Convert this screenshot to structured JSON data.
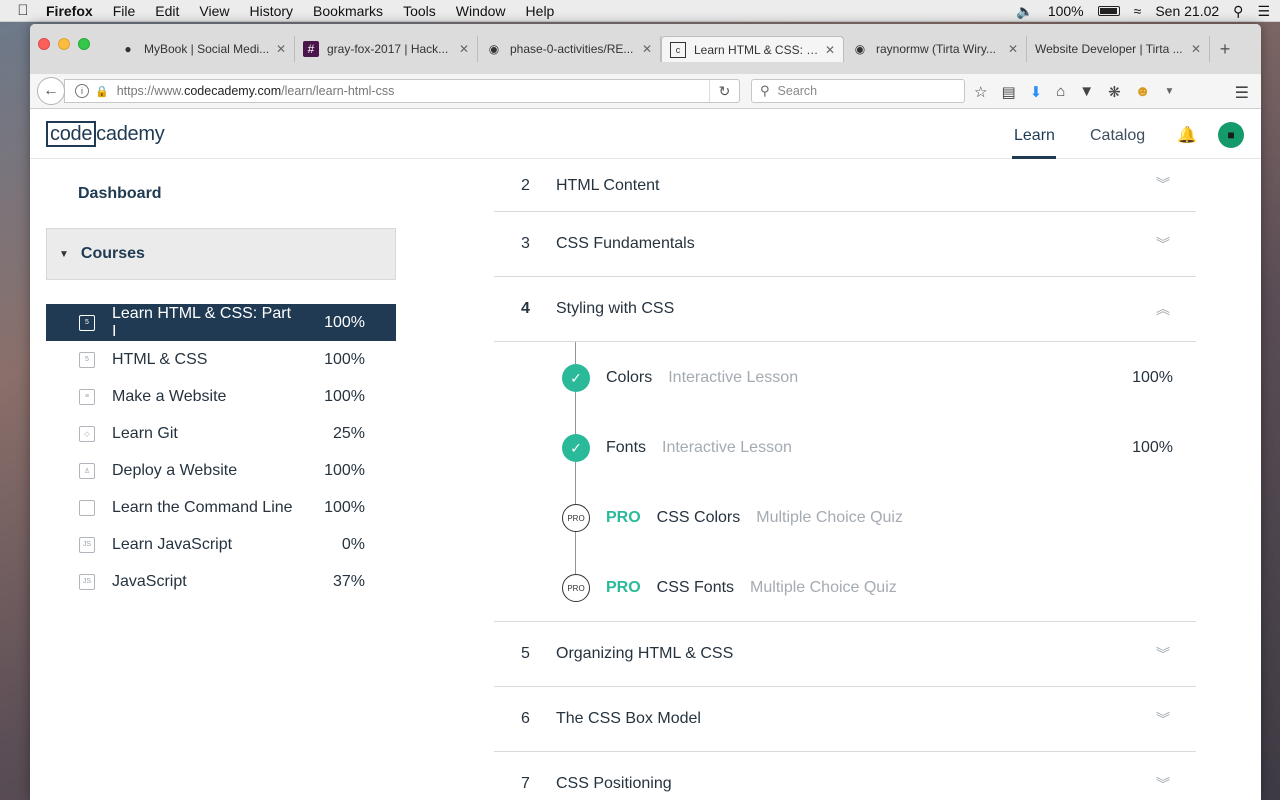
{
  "menubar": {
    "apple": "",
    "items": [
      "Firefox",
      "File",
      "Edit",
      "View",
      "History",
      "Bookmarks",
      "Tools",
      "Window",
      "Help"
    ],
    "volume_icon": "speaker-icon",
    "battery_text": "100%",
    "wifi_icon": "wifi-icon",
    "clock": "Sen 21.02",
    "search_icon": "spotlight-icon",
    "list_icon": "notification-list-icon"
  },
  "tabs": [
    {
      "title": "MyBook | Social Medi...",
      "icon": "mybook-icon"
    },
    {
      "title": "gray-fox-2017 | Hack...",
      "icon": "slack-hash-icon"
    },
    {
      "title": "phase-0-activities/RE...",
      "icon": "github-icon"
    },
    {
      "title": "Learn HTML & CSS: P...",
      "icon": "codecademy-icon",
      "active": true
    },
    {
      "title": "raynormw (Tirta Wiry...",
      "icon": "github-icon"
    },
    {
      "title": "Website Developer | Tirta ...",
      "icon": "none"
    }
  ],
  "newtab_label": "+",
  "urlbar": {
    "url_prefix": "https://www.",
    "url_domain": "codecademy.com",
    "url_path": "/learn/learn-html-css"
  },
  "searchbar": {
    "placeholder": "Search"
  },
  "site": {
    "logo_box": "code",
    "logo_rest": "cademy",
    "nav_learn": "Learn",
    "nav_catalog": "Catalog",
    "brand_color": "#1f3a52",
    "accent_color": "#2aba9a"
  },
  "sidebar": {
    "dashboard": "Dashboard",
    "courses_label": "Courses",
    "courses": [
      {
        "name": "Learn HTML & CSS: Part I",
        "pct": "100%",
        "icon": "html5-icon",
        "icon_text": "5",
        "active": true
      },
      {
        "name": "HTML & CSS",
        "pct": "100%",
        "icon": "html5-icon",
        "icon_text": "5"
      },
      {
        "name": "Make a Website",
        "pct": "100%",
        "icon": "website-icon",
        "icon_text": "≡"
      },
      {
        "name": "Learn Git",
        "pct": "25%",
        "icon": "git-icon",
        "icon_text": "◇"
      },
      {
        "name": "Deploy a Website",
        "pct": "100%",
        "icon": "rocket-icon",
        "icon_text": "♙"
      },
      {
        "name": "Learn the Command Line",
        "pct": "100%",
        "icon": "terminal-icon",
        "icon_text": ""
      },
      {
        "name": "Learn JavaScript",
        "pct": "0%",
        "icon": "js-icon",
        "icon_text": "JS"
      },
      {
        "name": "JavaScript",
        "pct": "37%",
        "icon": "js-icon",
        "icon_text": "JS"
      }
    ]
  },
  "units_before": [
    {
      "num": "2",
      "title": "HTML Content"
    },
    {
      "num": "3",
      "title": "CSS Fundamentals"
    }
  ],
  "open_unit": {
    "num": "4",
    "title": "Styling with CSS"
  },
  "lessons": [
    {
      "name": "Colors",
      "type": "Interactive Lesson",
      "pct": "100%",
      "status": "done"
    },
    {
      "name": "Fonts",
      "type": "Interactive Lesson",
      "pct": "100%",
      "status": "done"
    },
    {
      "pro": "PRO",
      "name": "CSS Colors",
      "type": "Multiple Choice Quiz",
      "status": "pro",
      "badge": "PRO"
    },
    {
      "pro": "PRO",
      "name": "CSS Fonts",
      "type": "Multiple Choice Quiz",
      "status": "pro",
      "badge": "PRO"
    }
  ],
  "units_after": [
    {
      "num": "5",
      "title": "Organizing HTML & CSS"
    },
    {
      "num": "6",
      "title": "The CSS Box Model"
    },
    {
      "num": "7",
      "title": "CSS Positioning"
    }
  ]
}
